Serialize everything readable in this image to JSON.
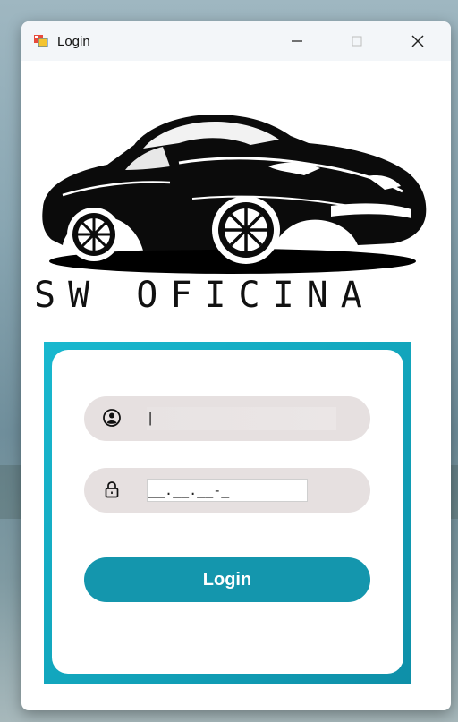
{
  "window": {
    "title": "Login",
    "controls": {
      "minimize": "—",
      "maximize": "☐",
      "close": "✕"
    }
  },
  "brand": {
    "name": "SW OFICINA"
  },
  "form": {
    "username": {
      "value": "|"
    },
    "password": {
      "value": "__.__.__-_"
    },
    "login_label": "Login"
  },
  "colors": {
    "accent": "#1496ad",
    "panel_border": "#19b8cf",
    "field_bg": "#e6e0e0"
  },
  "icons": [
    "app-icon",
    "user-icon",
    "lock-icon"
  ]
}
